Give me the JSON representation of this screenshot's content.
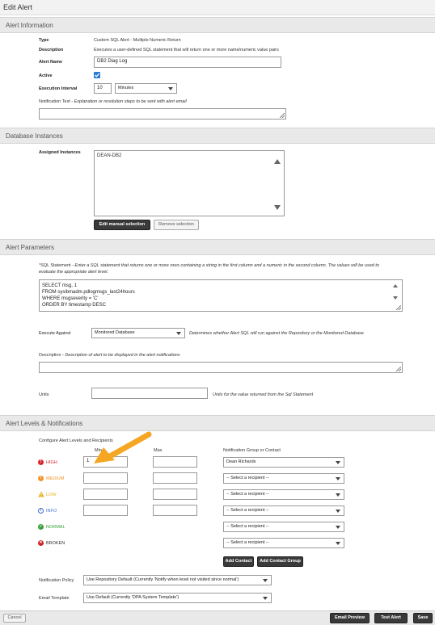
{
  "window": {
    "title": "Edit Alert"
  },
  "sections": {
    "alert_info": "Alert Information",
    "db_instances": "Database Instances",
    "alert_params": "Alert Parameters",
    "alert_levels": "Alert Levels & Notifications"
  },
  "alert_info": {
    "type_label": "Type",
    "type_value": "Custom SQL Alert - Multiple Numeric Return",
    "description_label": "Description",
    "description_value": "Executes a user-defined SQL statement that will return one or more name/numeric value pairs",
    "name_label": "Alert Name",
    "name_value": "DB2 Diag Log",
    "active_label": "Active",
    "active_checked": true,
    "interval_label": "Execution Interval",
    "interval_value": "10",
    "interval_unit": "Minutes",
    "notification_label": "Notification Text",
    "notification_hint": " - Explanation or resolution steps to be sent with alert email"
  },
  "db_instances": {
    "assigned_label": "Assigned Instances",
    "instances": [
      "DEAN-DB2"
    ],
    "edit_button": "Edit manual selection",
    "remove_button": "Remove selection"
  },
  "alert_params": {
    "required_mark": "*",
    "sql_label": "SQL Statement",
    "sql_hint": " - Enter a SQL statement that returns one or more rows containing a string in the first column and a numeric in the second column.  The values will be used to evaluate the appropriate alert level.",
    "sql_lines": [
      "SELECT msg, 1",
      "FROM sysibmadm.pdlogmsgs_last24hours",
      "WHERE msgseverity = 'C'",
      "ORDER BY timestamp DESC"
    ],
    "execute_label": "Execute Against",
    "execute_value": "Monitored Database",
    "execute_hint": "Determines whether Alert SQL will run against the Repository or the Monitored Database",
    "description_label": "Description",
    "description_hint": " - Description of alert to be displayed in the alert notifications",
    "units_label": "Units",
    "units_hint": "Units for the value returned from the Sql Statement"
  },
  "alert_levels": {
    "configure_label": "Configure Alert Levels and Recipients",
    "min_header": "Min",
    "max_header": "Max",
    "group_header": "Notification Group or Contact",
    "levels": [
      {
        "name": "HIGH",
        "min": "1",
        "max": "",
        "recipient": "Dean Richards",
        "color": "#d9262c",
        "icon": "!"
      },
      {
        "name": "MEDIUM",
        "min": "",
        "max": "",
        "recipient": "-- Select a recipient --",
        "color": "#f0962a",
        "icon": "!"
      },
      {
        "name": "LOW",
        "min": "",
        "max": "",
        "recipient": "-- Select a recipient --",
        "color": "#e8b020",
        "icon": "!"
      },
      {
        "name": "INFO",
        "min": "",
        "max": "",
        "recipient": "-- Select a recipient --",
        "color": "#3b6fd1",
        "icon": "i"
      },
      {
        "name": "NORMAL",
        "recipient": "-- Select a recipient --",
        "color": "#3aa13a",
        "icon": "✓"
      },
      {
        "name": "BROKEN",
        "recipient": "-- Select a recipient --",
        "color": "#cc2222",
        "icon": "✕"
      }
    ],
    "add_contact": "Add Contact",
    "add_contact_group": "Add Contact Group",
    "policy_label": "Notification Policy",
    "policy_value": "Use Repository Default (Currently 'Notify when level not visited since normal')",
    "template_label": "Email Template",
    "template_value": "Use Default (Currently 'DPA System Template')"
  },
  "footer": {
    "cancel": "Cancel",
    "email_preview": "Email Preview",
    "test_alert": "Test Alert",
    "save": "Save"
  },
  "annotation": {
    "arrow_color": "#f5a623"
  }
}
